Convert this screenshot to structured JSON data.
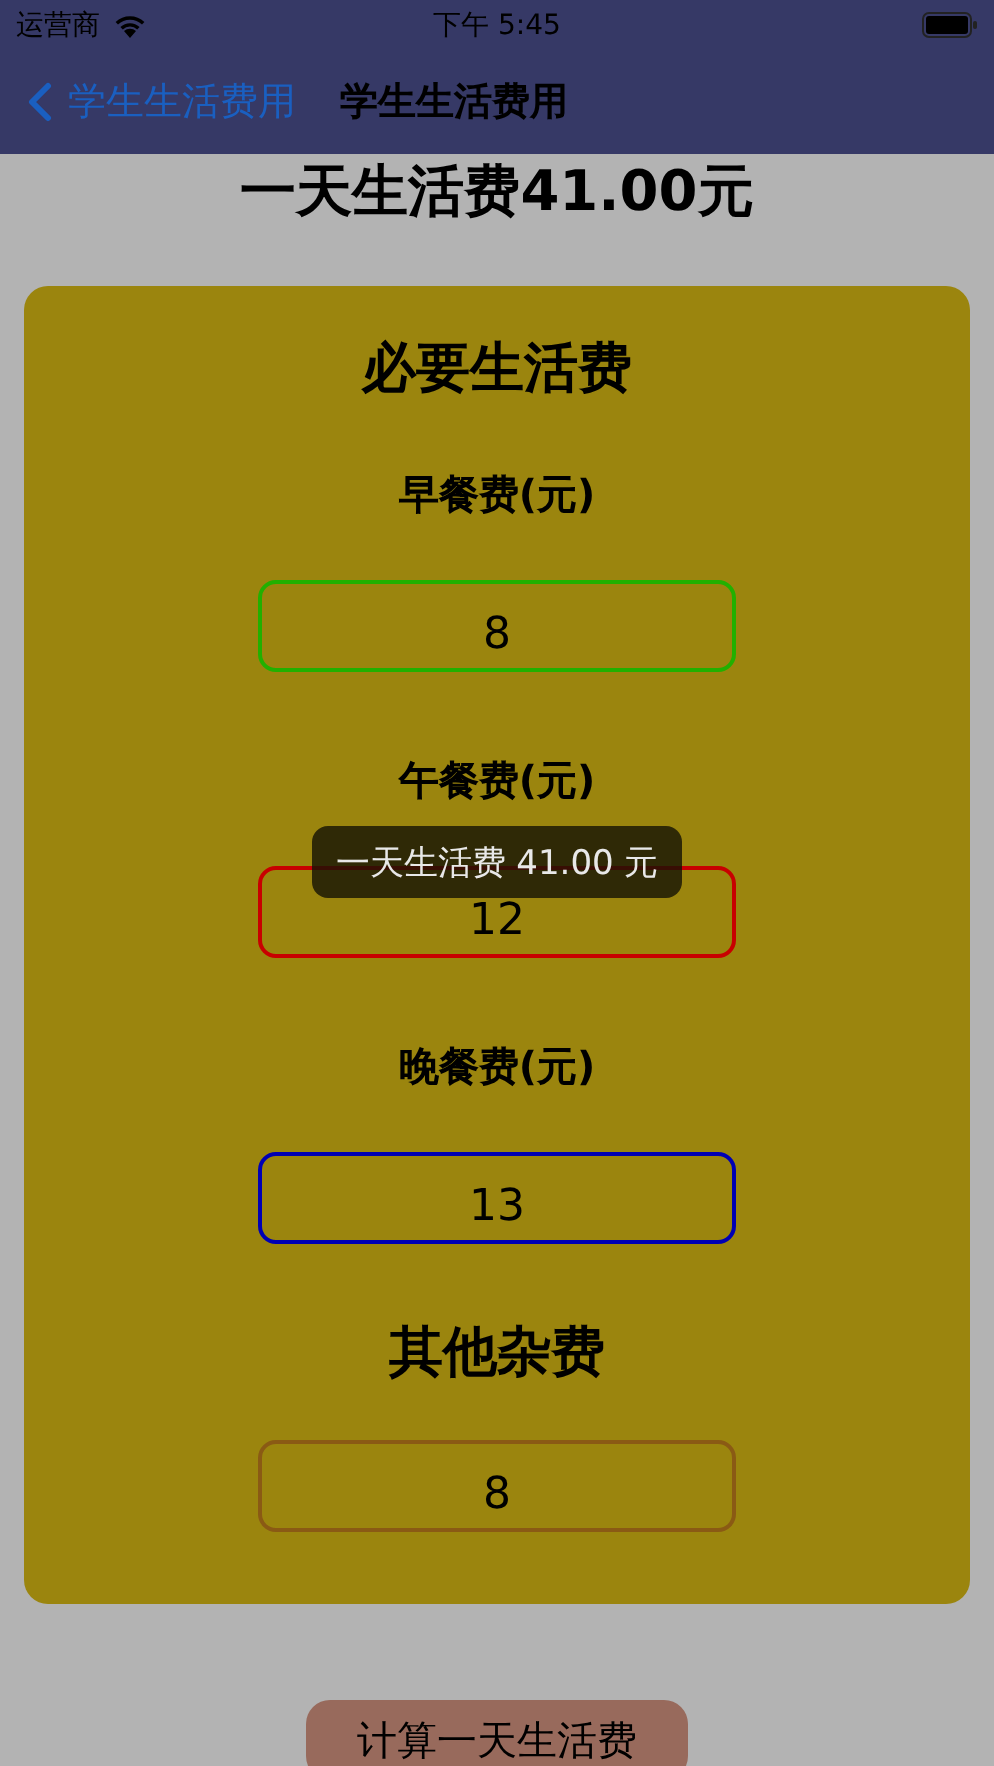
{
  "status_bar": {
    "carrier": "运营商",
    "time": "下午 5:45"
  },
  "nav": {
    "back": "学生生活费用",
    "title": "学生生活费用"
  },
  "headline": "一天生活费41.00元",
  "card": {
    "items": [
      {
        "kind": "heading",
        "text": "必要生活费"
      },
      {
        "kind": "field",
        "label": "早餐费(元)",
        "value": "8",
        "color": "#22b000"
      },
      {
        "kind": "field",
        "label": "午餐费(元)",
        "value": "12",
        "color": "#c80000"
      },
      {
        "kind": "field",
        "label": "晚餐费(元)",
        "value": "13",
        "color": "#0000b4"
      },
      {
        "kind": "heading",
        "text": "其他杂费"
      },
      {
        "kind": "field",
        "value": "8",
        "color": "#8a5a14"
      }
    ]
  },
  "button": "计算一天生活费",
  "toast": "一天生活费 41.00 元"
}
